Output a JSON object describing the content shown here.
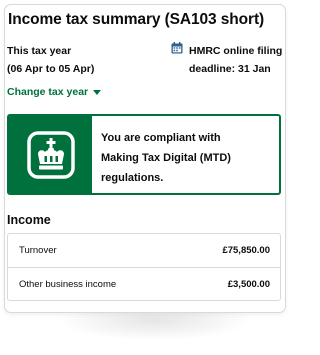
{
  "title": "Income tax summary (SA103 short)",
  "tax_year": {
    "line1": "This tax year",
    "line2": "(06 Apr to 05 Apr)"
  },
  "filing": {
    "icon": "calendar-icon",
    "line1": "HMRC online filing",
    "line2": "deadline: 31 Jan"
  },
  "change_tax_year": {
    "label": "Change tax year",
    "icon": "caret-down-icon"
  },
  "mtd": {
    "icon": "crown-icon",
    "line1": "You are compliant with",
    "line2": "Making Tax Digital (MTD)",
    "line3": "regulations."
  },
  "income": {
    "heading": "Income",
    "rows": [
      {
        "label": "Turnover",
        "value": "£75,850.00"
      },
      {
        "label": "Other business income",
        "value": "£3,500.00"
      }
    ]
  },
  "colors": {
    "brand_green": "#00703c",
    "text": "#0b0c0c",
    "border": "#d7d9db",
    "calendar_blue": "#2d5f8a"
  }
}
